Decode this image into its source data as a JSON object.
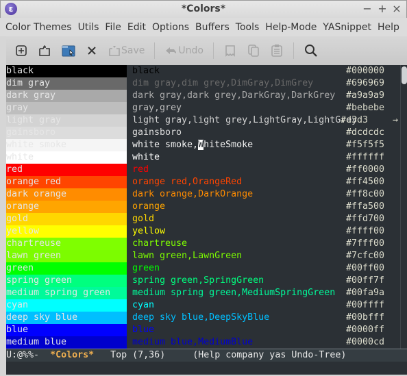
{
  "window": {
    "title": "*Colors*",
    "controls": [
      "−",
      "+",
      "×"
    ]
  },
  "menubar": [
    "Color Themes",
    "Utils",
    "File",
    "Edit",
    "Options",
    "Buffers",
    "Tools",
    "Help-Mode",
    "YASnippet",
    "Help"
  ],
  "toolbar": {
    "save_label": "Save",
    "undo_label": "Undo"
  },
  "colors": [
    {
      "sample": "black",
      "names": "black",
      "hex": "#000000",
      "bg": "#000000",
      "fg": "#000000"
    },
    {
      "sample": "dim gray",
      "names": "dim gray,dim grey,DimGray,DimGrey",
      "hex": "#696969",
      "bg": "#696969",
      "fg": "#696969"
    },
    {
      "sample": "dark gray",
      "names": "dark gray,dark grey,DarkGray,DarkGrey",
      "hex": "#a9a9a9",
      "bg": "#a9a9a9",
      "fg": "#a9a9a9"
    },
    {
      "sample": "gray",
      "names": "gray,grey",
      "hex": "#bebebe",
      "bg": "#bebebe",
      "fg": "#bebebe"
    },
    {
      "sample": "light gray",
      "names": "light gray,light grey,LightGray,LightGrey",
      "hex": "#d3d3",
      "bg": "#d3d3d3",
      "fg": "#d3d3d3",
      "truncated": "→"
    },
    {
      "sample": "gainsboro",
      "names": "gainsboro",
      "hex": "#dcdcdc",
      "bg": "#dcdcdc",
      "fg": "#dcdcdc"
    },
    {
      "sample": "white smoke",
      "names": "white smoke,WhiteSmoke",
      "hex": "#f5f5f5",
      "bg": "#f5f5f5",
      "fg": "#f5f5f5"
    },
    {
      "sample": "white",
      "names": "white",
      "hex": "#ffffff",
      "bg": "#ffffff",
      "fg": "#ffffff"
    },
    {
      "sample": "red",
      "names": "red",
      "hex": "#ff0000",
      "bg": "#ff0000",
      "fg": "#ff0000"
    },
    {
      "sample": "orange red",
      "names": "orange red,OrangeRed",
      "hex": "#ff4500",
      "bg": "#ff4500",
      "fg": "#ff4500"
    },
    {
      "sample": "dark orange",
      "names": "dark orange,DarkOrange",
      "hex": "#ff8c00",
      "bg": "#ff8c00",
      "fg": "#ff8c00"
    },
    {
      "sample": "orange",
      "names": "orange",
      "hex": "#ffa500",
      "bg": "#ffa500",
      "fg": "#ffa500"
    },
    {
      "sample": "gold",
      "names": "gold",
      "hex": "#ffd700",
      "bg": "#ffd700",
      "fg": "#ffd700"
    },
    {
      "sample": "yellow",
      "names": "yellow",
      "hex": "#ffff00",
      "bg": "#ffff00",
      "fg": "#ffff00"
    },
    {
      "sample": "chartreuse",
      "names": "chartreuse",
      "hex": "#7fff00",
      "bg": "#7fff00",
      "fg": "#7fff00"
    },
    {
      "sample": "lawn green",
      "names": "lawn green,LawnGreen",
      "hex": "#7cfc00",
      "bg": "#7cfc00",
      "fg": "#7cfc00"
    },
    {
      "sample": "green",
      "names": "green",
      "hex": "#00ff00",
      "bg": "#00ff00",
      "fg": "#00ff00"
    },
    {
      "sample": "spring green",
      "names": "spring green,SpringGreen",
      "hex": "#00ff7f",
      "bg": "#00ff7f",
      "fg": "#00ff7f"
    },
    {
      "sample": "medium spring green",
      "names": "medium spring green,MediumSpringGreen",
      "hex": "#00fa9a",
      "bg": "#00fa9a",
      "fg": "#00fa9a"
    },
    {
      "sample": "cyan",
      "names": "cyan",
      "hex": "#00ffff",
      "bg": "#00ffff",
      "fg": "#00ffff"
    },
    {
      "sample": "deep sky blue",
      "names": "deep sky blue,DeepSkyBlue",
      "hex": "#00bfff",
      "bg": "#00bfff",
      "fg": "#00bfff"
    },
    {
      "sample": "blue",
      "names": "blue",
      "hex": "#0000ff",
      "bg": "#0000ff",
      "fg": "#0000ff"
    },
    {
      "sample": "medium blue",
      "names": "medium blue,MediumBlue",
      "hex": "#0000cd",
      "bg": "#0000cd",
      "fg": "#0000cd"
    }
  ],
  "modeline": {
    "status": "U:@%%-",
    "buffer": "*Colors*",
    "position": "Top (7,36)",
    "modes": "(Help company yas Undo-Tree)"
  }
}
